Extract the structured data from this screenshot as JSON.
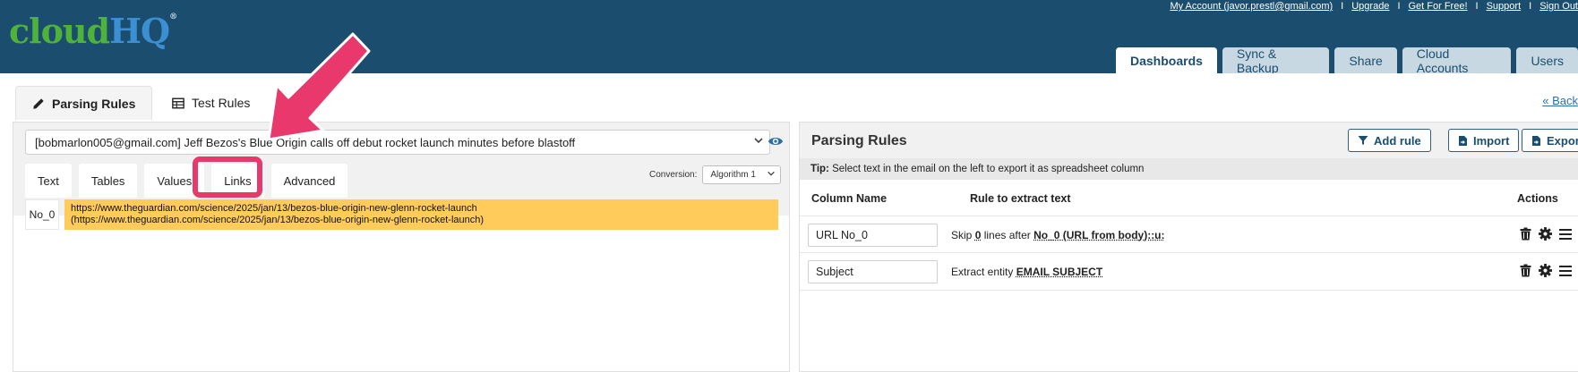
{
  "brand": {
    "part1": "cloud",
    "part2": "HQ",
    "reg": "®"
  },
  "top_links": [
    "My Account (javor.prestl@gmail.com)",
    "Upgrade",
    "Get For Free!",
    "Support",
    "Sign Out"
  ],
  "top_sep": "I",
  "main_tabs": [
    "Dashboards",
    "Sync & Backup",
    "Share",
    "Cloud Accounts",
    "Users"
  ],
  "sub_tabs": {
    "parsing": "Parsing Rules",
    "test": "Test Rules"
  },
  "back_link": "« Back",
  "left": {
    "email_subject": "[bobmarlon005@gmail.com] Jeff Bezos's Blue Origin calls off debut rocket launch minutes before blastoff",
    "inner_tabs": [
      "Text",
      "Tables",
      "Values",
      "Links",
      "Advanced"
    ],
    "conversion_label": "Conversion:",
    "conversion_value": "Algorithm 1",
    "row": {
      "label": "No_0",
      "line1": "https://www.theguardian.com/science/2025/jan/13/bezos-blue-origin-new-glenn-rocket-launch",
      "line2": "(https://www.theguardian.com/science/2025/jan/13/bezos-blue-origin-new-glenn-rocket-launch)"
    }
  },
  "right": {
    "title": "Parsing Rules",
    "buttons": {
      "add": "Add rule",
      "import": "Import",
      "export": "Export"
    },
    "tip_label": "Tip:",
    "tip_text": " Select text in the email on the left to export it as spreadsheet column",
    "headers": {
      "column": "Column Name",
      "rule": "Rule to extract text",
      "actions": "Actions"
    },
    "rules": [
      {
        "name": "URL No_0",
        "pre": "Skip ",
        "num": "0",
        "mid": " lines after ",
        "bold": "No_0 (URL from body)::u:"
      },
      {
        "name": "Subject",
        "pre": "Extract entity ",
        "bold": "EMAIL SUBJECT"
      }
    ]
  },
  "colors": {
    "header": "#1b4e6e",
    "highlight": "#e8386c",
    "row_fill": "#ffcc5c",
    "logo_green": "#4fb23a",
    "logo_blue": "#3c8fd2"
  }
}
